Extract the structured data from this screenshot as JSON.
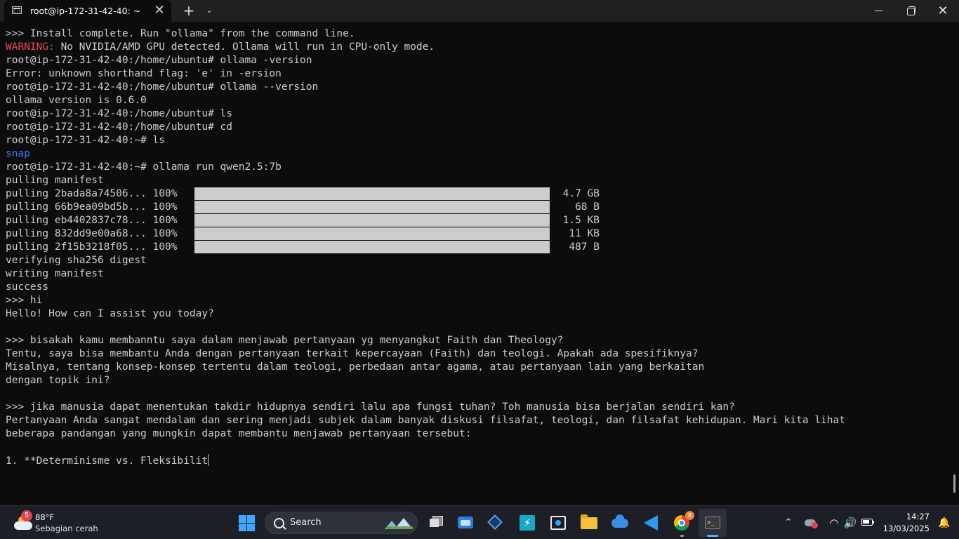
{
  "window": {
    "tab_title": "root@ip-172-31-42-40: ~",
    "tab_icon_text": "C:\\",
    "close_tab_glyph": "✕",
    "new_tab_glyph": "+",
    "dropdown_glyph": "⌄",
    "close_window_glyph": "✕"
  },
  "terminal": {
    "lines": [
      ">>> Install complete. Run \"ollama\" from the command line.",
      "WARNING:",
      "root@ip-172-31-42-40:/home/ubuntu# ollama -version",
      "Error: unknown shorthand flag: 'e' in -ersion",
      "root@ip-172-31-42-40:/home/ubuntu# ollama --version",
      "ollama version is 0.6.0",
      "root@ip-172-31-42-40:/home/ubuntu# ls",
      "root@ip-172-31-42-40:/home/ubuntu# cd",
      "root@ip-172-31-42-40:~# ls",
      "snap",
      "root@ip-172-31-42-40:~# ollama run qwen2.5:7b",
      "pulling manifest",
      "pulling 2bada8a74506... 100%",
      "pulling 66b9ea09bd5b... 100%",
      "pulling eb4402837c78... 100%",
      "pulling 832dd9e00a68... 100%",
      "pulling 2f15b3218f05... 100%",
      "verifying sha256 digest",
      "writing manifest",
      "success",
      ">>> hi",
      "Hello! How can I assist you today?",
      "",
      ">>> bisakah kamu membanntu saya dalam menjawab pertanyaan yg menyangkut Faith dan Theology?",
      "Tentu, saya bisa membantu Anda dengan pertanyaan terkait kepercayaan (Faith) dan teologi. Apakah ada spesifiknya?",
      "Misalnya, tentang konsep-konsep tertentu dalam teologi, perbedaan antar agama, atau pertanyaan lain yang berkaitan",
      "dengan topik ini?",
      "",
      ">>> jika manusia dapat menentukan takdir hidupnya sendiri lalu apa fungsi tuhan? Toh manusia bisa berjalan sendiri kan?",
      "Pertanyaan Anda sangat mendalam dan sering menjadi subjek dalam banyak diskusi filsafat, teologi, dan filsafat kehidupan. Mari kita lihat",
      "beberapa pandangan yang mungkin dapat membantu menjawab pertanyaan tersebut:",
      "",
      "1. **Determinisme vs. Fleksibilit"
    ],
    "warning_rest": " No NVIDIA/AMD GPU detected. Ollama will run in CPU-only mode.",
    "pull_sizes": [
      "4.7 GB",
      "68 B",
      "1.5 KB",
      "11 KB",
      "487 B"
    ]
  },
  "taskbar": {
    "weather_temp": "88°F",
    "weather_desc": "Sebagian cerah",
    "weather_badge": "5",
    "search_label": "Search",
    "chrome_badge": "8",
    "terminal_glyph": ">_",
    "bolt_glyph": "⚡",
    "chevron_glyph": "⌃",
    "wifi_glyph": "◠",
    "speaker_glyph": "🔊",
    "bell_glyph": "🔔",
    "clock_time": "14:27",
    "clock_date": "13/03/2025"
  },
  "colors": {
    "warning": "#e74856",
    "directory": "#3b78ff",
    "terminal_bg": "#0c0c0c",
    "terminal_fg": "#cccccc"
  }
}
